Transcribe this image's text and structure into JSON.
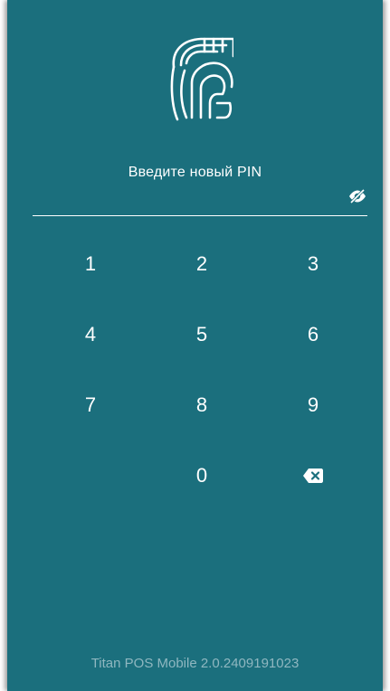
{
  "app": {
    "logo_icon": "spartan-helmet-icon",
    "background_color": "#1b6f7d",
    "accent_color": "#ffffff"
  },
  "pin": {
    "title": "Введите новый PIN",
    "value": "",
    "visibility_icon": "eye-off-icon"
  },
  "keypad": {
    "key1": "1",
    "key2": "2",
    "key3": "3",
    "key4": "4",
    "key5": "5",
    "key6": "6",
    "key7": "7",
    "key8": "8",
    "key9": "9",
    "key0": "0",
    "backspace_icon": "backspace-icon"
  },
  "footer": {
    "version": "Titan POS Mobile 2.0.2409191023"
  }
}
